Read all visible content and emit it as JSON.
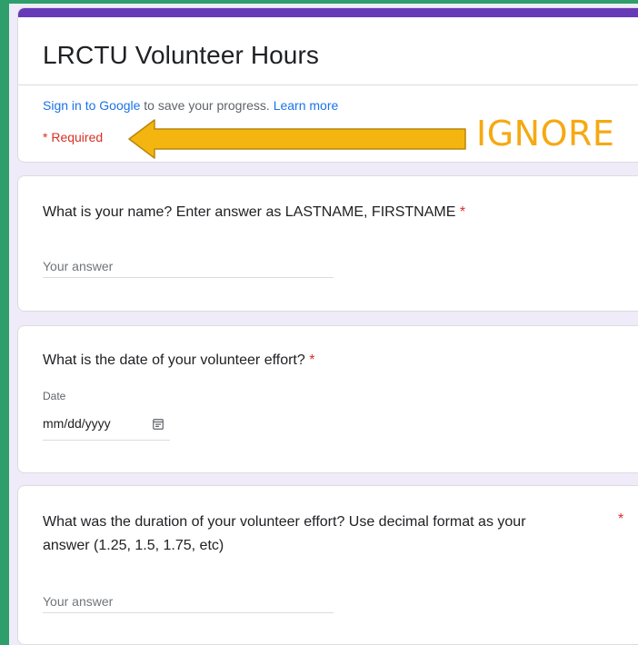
{
  "form": {
    "title": "LRCTU Volunteer Hours",
    "signin_link": "Sign in to Google",
    "signin_rest": " to save your progress. ",
    "learn_more": "Learn more",
    "required_note": "* Required"
  },
  "annotation": {
    "text": "IGNORE",
    "color": "#f5a912"
  },
  "questions": [
    {
      "text": "What is your name? Enter answer as LASTNAME, FIRSTNAME",
      "required_mark": "*",
      "placeholder": "Your answer"
    },
    {
      "text": "What is the date of your volunteer effort?",
      "required_mark": "*",
      "sublabel": "Date",
      "value": "mm/dd/yyyy",
      "icon": "calendar-icon"
    },
    {
      "text_line1": "What was the duration of your volunteer effort? Use decimal format as your",
      "text_line2": "answer (1.25, 1.5, 1.75, etc)",
      "required_mark": "*",
      "placeholder": "Your answer"
    }
  ],
  "colors": {
    "accent": "#673ab7",
    "link": "#1a73e8",
    "required": "#d93025",
    "outer_border": "#2e9e6a"
  }
}
